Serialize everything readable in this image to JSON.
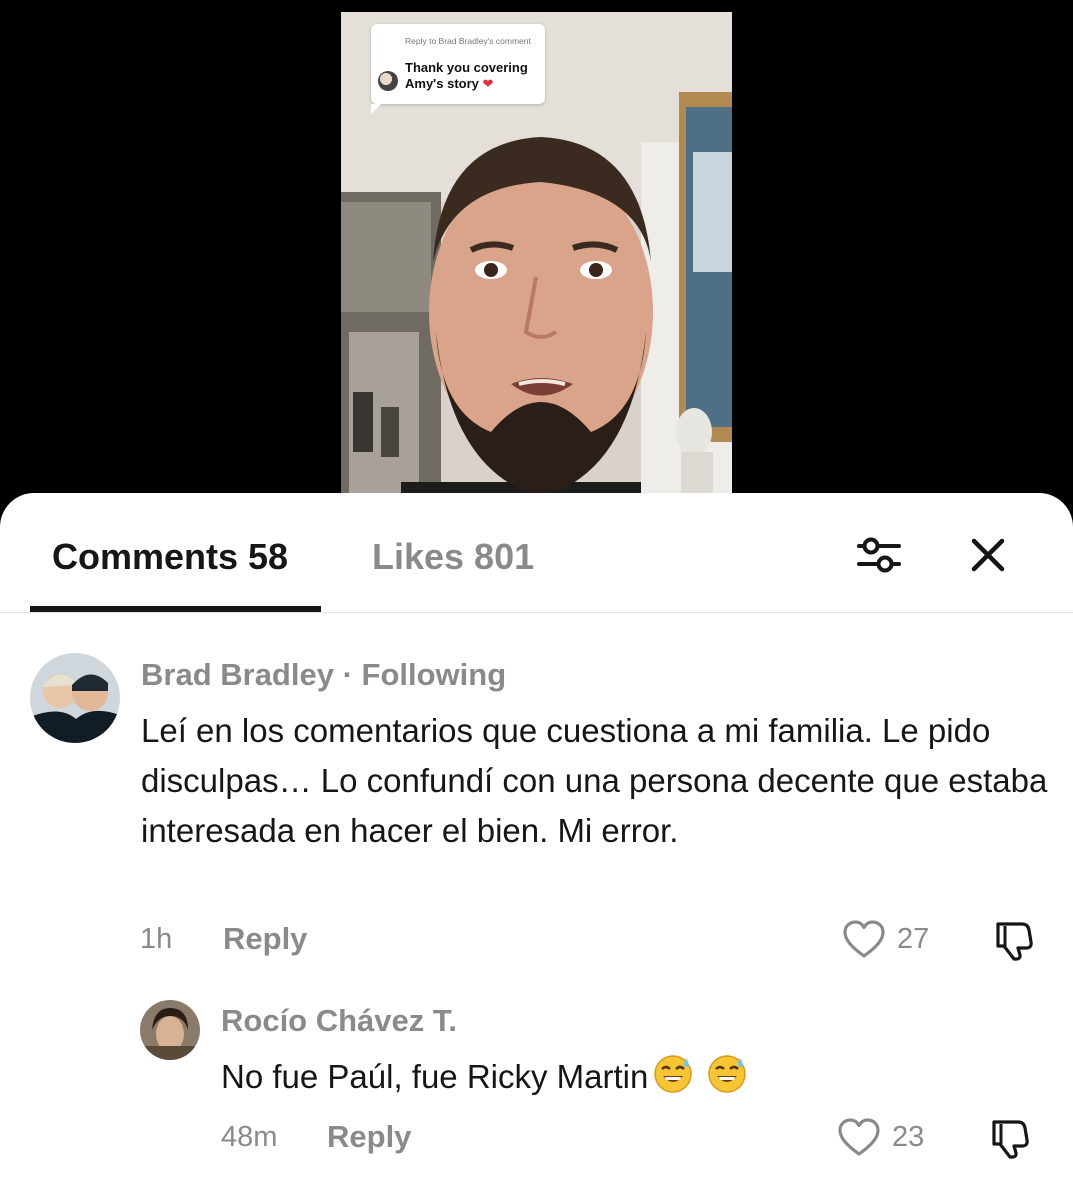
{
  "video": {
    "reply_bubble": {
      "reply_to": "Reply to Brad Bradley's comment",
      "text": "Thank you covering Amy's story",
      "emoji_icon": "red-heart-icon"
    }
  },
  "tabs": {
    "comments_label": "Comments 58",
    "likes_label": "Likes 801",
    "filter_icon": "filter-sliders-icon",
    "close_icon": "close-icon"
  },
  "comments": [
    {
      "username": "Brad Bradley · Following",
      "text": "Leí en los comentarios que cuestiona a mi familia. Le pido disculpas… Lo confundí con una persona decente que estaba interesada en hacer el bien. Mi error.",
      "time": "1h",
      "reply_label": "Reply",
      "likes": "27"
    },
    {
      "username": "Rocío Chávez T.",
      "text": "No fue Paúl, fue Ricky Martin",
      "emoji": [
        "sweat-smile-emoji",
        "sweat-smile-emoji"
      ],
      "time": "48m",
      "reply_label": "Reply",
      "likes": "23"
    }
  ],
  "colors": {
    "primary_text": "#161616",
    "secondary_text": "#8a8a8a",
    "sheet_background": "#ffffff"
  }
}
